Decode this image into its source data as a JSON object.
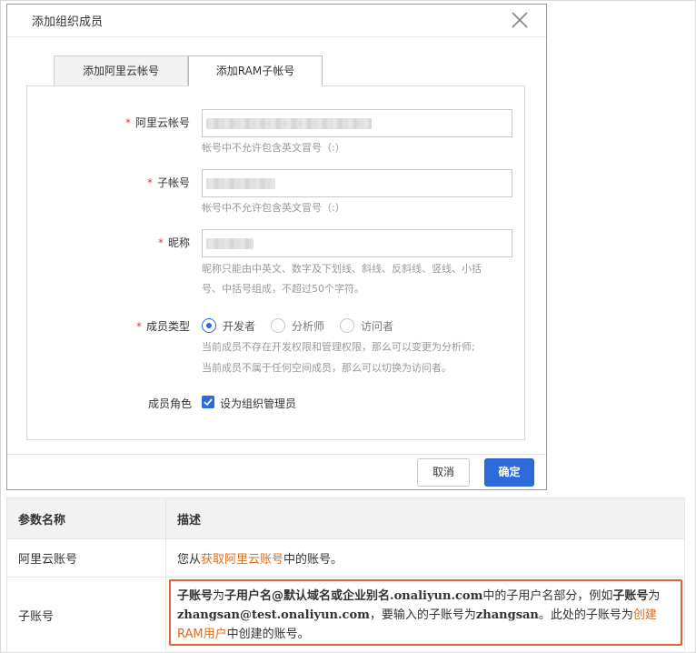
{
  "dialog": {
    "title": "添加组织成员",
    "tabs": [
      {
        "label": "添加阿里云帐号"
      },
      {
        "label": "添加RAM子帐号"
      }
    ],
    "fields": {
      "aliyun_account": {
        "label": "阿里云帐号",
        "hint": "帐号中不允许包含英文冒号（:）"
      },
      "sub_account": {
        "label": "子帐号",
        "hint": "帐号中不允许包含英文冒号（:）"
      },
      "nickname": {
        "label": "昵称",
        "hint_line1": "昵称只能由中英文、数字及下划线、斜线、反斜线、竖线、小括",
        "hint_line2": "号、中括号组成，不超过50个字符。"
      },
      "member_type": {
        "label": "成员类型",
        "options": [
          {
            "label": "开发者",
            "checked": true
          },
          {
            "label": "分析师",
            "checked": false
          },
          {
            "label": "访问者",
            "checked": false
          }
        ],
        "hint_line1": "当前成员不存在开发权限和管理权限，那么可以变更为分析师;",
        "hint_line2": "当前成员不属于任何空间成员，那么可以切换为访问者。"
      },
      "member_role": {
        "label": "成员角色",
        "checkbox_label": "设为组织管理员",
        "checked": true
      }
    },
    "buttons": {
      "cancel": "取消",
      "ok": "确定"
    }
  },
  "table": {
    "headers": [
      "参数名称",
      "描述"
    ],
    "rows": [
      {
        "name": "阿里云账号",
        "desc_pre": "您从",
        "desc_link": "获取阿里云账号",
        "desc_post": "中的账号。"
      },
      {
        "name": "子账号"
      }
    ],
    "sub_desc": {
      "b1": "子账号",
      "t1": "为",
      "b2": "子用户名@默认域名或企业别名",
      "m1": ".onaliyun.com",
      "t2": "中的子用户名部分，例如",
      "b3": "子账号",
      "t3": "为",
      "m2": "zhangsan@test.onaliyun.com",
      "t4": "，要输入的子账号为",
      "m3": "zhangsan",
      "t5": "。此处的子账号为",
      "link": "创建RAM用户",
      "t6": "中创建的账号。"
    }
  },
  "colors": {
    "primary": "#2c6bd9",
    "required": "#e03d3d",
    "link": "#e06d18",
    "highlight_border": "#e0623a"
  }
}
